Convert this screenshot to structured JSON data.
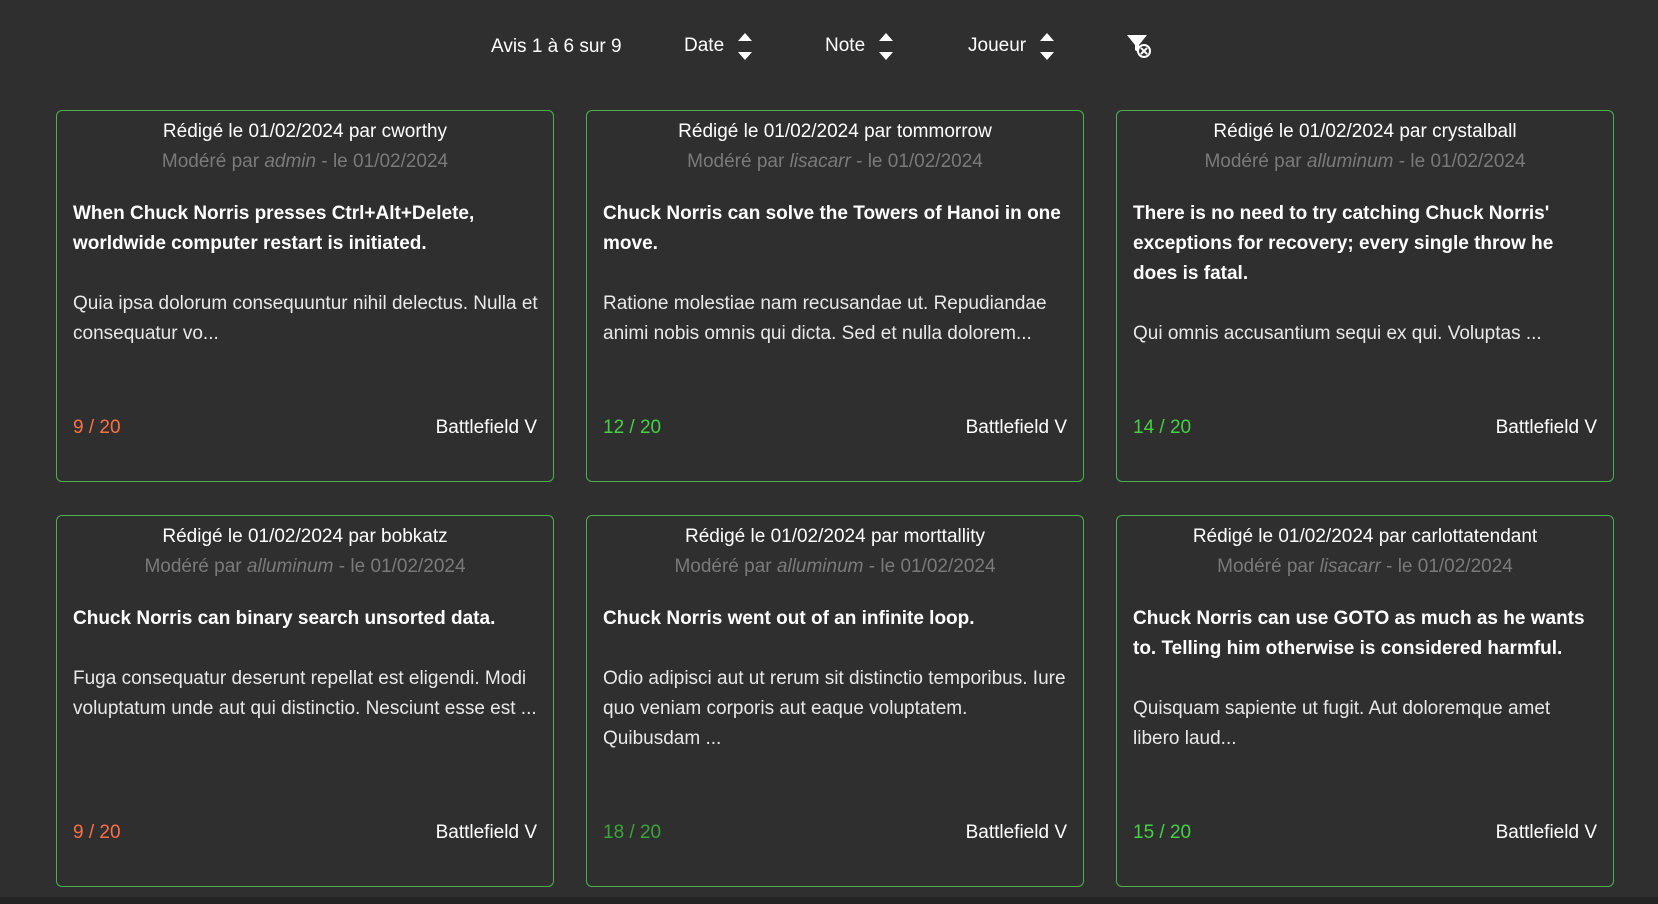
{
  "toolbar": {
    "count_text": "Avis 1 à 6 sur 9",
    "sort_options": [
      {
        "label": "Date"
      },
      {
        "label": "Note"
      },
      {
        "label": "Joueur"
      }
    ],
    "clear_filter_icon": "filter-clear-icon"
  },
  "colors": {
    "background": "#2f2f2f",
    "card_border": "#4caf50",
    "score_low": "#ff7043",
    "score_mid": "#4caf50",
    "score_high": "#43d143",
    "muted_text": "#7a7a7a"
  },
  "reviews": [
    {
      "written": "Rédigé le 01/02/2024 par cworthy",
      "moderated_prefix": "Modéré par ",
      "moderator": "admin",
      "moderated_suffix": " - le 01/02/2024",
      "headline": "When Chuck Norris presses Ctrl+Alt+Delete, worldwide computer restart is initiated.",
      "excerpt": "Quia ipsa dolorum consequuntur nihil delectus. Nulla et consequatur vo...",
      "score": "9 / 20",
      "score_color": "#ff7043",
      "game": "Battlefield V"
    },
    {
      "written": "Rédigé le 01/02/2024 par tommorrow",
      "moderated_prefix": "Modéré par ",
      "moderator": "lisacarr",
      "moderated_suffix": " - le 01/02/2024",
      "headline": "Chuck Norris can solve the Towers of Hanoi in one move.",
      "excerpt": "Ratione molestiae nam recusandae ut. Repudiandae animi nobis omnis qui dicta. Sed et nulla dolorem...",
      "score": "12 / 20",
      "score_color": "#43d143",
      "game": "Battlefield V"
    },
    {
      "written": "Rédigé le 01/02/2024 par crystalball",
      "moderated_prefix": "Modéré par ",
      "moderator": "alluminum",
      "moderated_suffix": " - le 01/02/2024",
      "headline": "There is no need to try catching Chuck Norris' exceptions for recovery; every single throw he does is fatal.",
      "excerpt": "Qui omnis accusantium sequi ex qui. Voluptas ...",
      "score": "14 / 20",
      "score_color": "#43d143",
      "game": "Battlefield V"
    },
    {
      "written": "Rédigé le 01/02/2024 par bobkatz",
      "moderated_prefix": "Modéré par ",
      "moderator": "alluminum",
      "moderated_suffix": " - le 01/02/2024",
      "headline": "Chuck Norris can binary search unsorted data.",
      "excerpt": "Fuga consequatur deserunt repellat est eligendi. Modi voluptatum unde aut qui distinctio. Nesciunt esse est ...",
      "score": "9 / 20",
      "score_color": "#ff7043",
      "game": "Battlefield V"
    },
    {
      "written": "Rédigé le 01/02/2024 par morttallity",
      "moderated_prefix": "Modéré par ",
      "moderator": "alluminum",
      "moderated_suffix": " - le 01/02/2024",
      "headline": "Chuck Norris went out of an infinite loop.",
      "excerpt": "Odio adipisci aut ut rerum sit distinctio temporibus. Iure quo veniam corporis aut eaque voluptatem. Quibusdam ...",
      "score": "18 / 20",
      "score_color": "#3aa53a",
      "game": "Battlefield V"
    },
    {
      "written": "Rédigé le 01/02/2024 par carlottatendant",
      "moderated_prefix": "Modéré par ",
      "moderator": "lisacarr",
      "moderated_suffix": " - le 01/02/2024",
      "headline": "Chuck Norris can use GOTO as much as he wants to. Telling him otherwise is considered harmful.",
      "excerpt": "Quisquam sapiente ut fugit. Aut doloremque amet libero laud...",
      "score": "15 / 20",
      "score_color": "#43d143",
      "game": "Battlefield V"
    }
  ]
}
